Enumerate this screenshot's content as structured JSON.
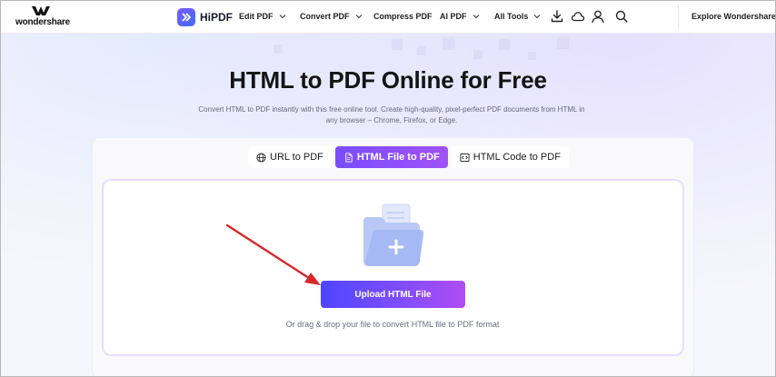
{
  "brand": {
    "company": "wondershare",
    "product": "HiPDF"
  },
  "nav": {
    "items": [
      {
        "label": "Edit PDF",
        "has_dropdown": true
      },
      {
        "label": "Convert PDF",
        "has_dropdown": true
      },
      {
        "label": "Compress PDF",
        "has_dropdown": false
      },
      {
        "label": "AI PDF",
        "has_dropdown": true
      },
      {
        "label": "All Tools",
        "has_dropdown": true
      }
    ],
    "icons": [
      "download-icon",
      "cloud-icon",
      "user-icon",
      "search-icon"
    ],
    "explore_label": "Explore Wondershare"
  },
  "hero": {
    "title": "HTML to PDF Online for Free",
    "subtitle": "Convert HTML to PDF instantly with this free online tool. Create high-quality, pixel-perfect PDF documents from HTML in any browser – Chrome, Firefox, or Edge."
  },
  "tabs": [
    {
      "label": "URL to PDF",
      "icon": "globe-icon",
      "active": false
    },
    {
      "label": "HTML File to PDF",
      "icon": "file-icon",
      "active": true
    },
    {
      "label": "HTML Code to PDF",
      "icon": "code-icon",
      "active": false
    }
  ],
  "upload": {
    "button_label": "Upload HTML File",
    "hint": "Or drag & drop your file to convert HTML file to PDF format"
  },
  "colors": {
    "accent_start": "#4f45ff",
    "accent_end": "#b14cf3",
    "annotation_arrow": "#d42a2a"
  }
}
